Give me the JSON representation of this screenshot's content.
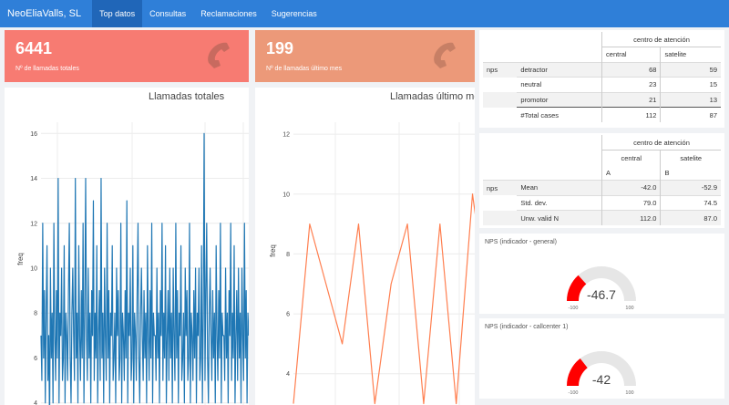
{
  "navbar": {
    "brand": "NeoEliaValls, SL",
    "items": [
      {
        "label": "Top datos",
        "active": true
      },
      {
        "label": "Consultas",
        "active": false
      },
      {
        "label": "Reclamaciones",
        "active": false
      },
      {
        "label": "Sugerencias",
        "active": false
      }
    ]
  },
  "value_boxes": [
    {
      "value": "6441",
      "label": "Nº de llamadas totales",
      "color": "#f77b72",
      "icon": "phone-icon"
    },
    {
      "value": "199",
      "label": "Nº de llamadas último mes",
      "color": "#ec9979",
      "icon": "phone-icon"
    }
  ],
  "table1": {
    "group_header": "centro de atención",
    "col_a": "central",
    "col_b": "satelite",
    "row_var": "nps",
    "rows": [
      {
        "label": "detractor",
        "a": "68",
        "b": "59"
      },
      {
        "label": "neutral",
        "a": "23",
        "b": "15"
      },
      {
        "label": "promotor",
        "a": "21",
        "b": "13"
      },
      {
        "label": "#Total cases",
        "a": "112",
        "b": "87"
      }
    ]
  },
  "table2": {
    "group_header": "centro de atención",
    "col_a": "central",
    "col_b": "satelite",
    "letter_a": "A",
    "letter_b": "B",
    "row_var": "nps",
    "rows": [
      {
        "label": "Mean",
        "a": "-42.0",
        "b": "-52.9"
      },
      {
        "label": "Std. dev.",
        "a": "79.0",
        "b": "74.5"
      },
      {
        "label": "Unw. valid N",
        "a": "112.0",
        "b": "87.0"
      }
    ]
  },
  "gauges": [
    {
      "title": "NPS (indicador - general)",
      "value": -46.7,
      "value_text": "-46.7",
      "min": -100,
      "max": 100,
      "min_text": "-100",
      "max_text": "100"
    },
    {
      "title": "NPS (indicador - callcenter 1)",
      "value": -42,
      "value_text": "-42",
      "min": -100,
      "max": 100,
      "min_text": "-100",
      "max_text": "100"
    }
  ],
  "colors": {
    "navbar": "#2f7fd8",
    "gauge_fill": "#ff0000",
    "gauge_track": "#e6e6e6",
    "chart1_line": "#1f77b4",
    "chart2_line": "#ff7f50"
  },
  "chart_data": [
    {
      "type": "line",
      "title": "Llamadas totales",
      "ylabel": "freq",
      "xlabel": "",
      "ylim": [
        3.5,
        16.5
      ],
      "yticks": [
        4,
        6,
        8,
        10,
        12,
        14,
        16
      ],
      "series": [
        {
          "values": [
            7,
            5,
            12,
            6,
            9,
            4,
            8,
            11,
            5,
            7,
            3,
            10,
            6,
            8,
            4,
            12,
            7,
            5,
            9,
            6,
            14,
            4,
            8,
            7,
            10,
            5,
            6,
            11,
            4,
            8,
            7,
            5,
            9,
            12,
            6,
            4,
            8,
            10,
            7,
            5,
            14,
            6,
            8,
            4,
            11,
            7,
            5,
            9,
            6,
            12,
            4,
            8,
            14,
            7,
            5,
            10,
            6,
            8,
            4,
            9,
            7,
            13,
            5,
            8,
            6,
            11,
            4,
            7,
            9,
            5,
            14,
            6,
            8,
            4,
            10,
            7,
            5,
            12,
            6,
            9,
            4,
            8,
            7,
            11,
            5,
            6,
            8,
            4,
            10,
            7,
            9,
            5,
            6,
            12,
            4,
            8,
            7,
            5,
            9,
            6,
            13,
            4,
            8,
            7,
            10,
            5,
            6,
            11,
            4,
            8,
            7,
            5,
            9,
            12,
            6,
            4,
            8,
            10,
            7,
            5,
            9,
            6,
            8,
            4,
            11,
            7,
            5,
            9,
            6,
            12,
            4,
            8,
            7,
            7,
            5,
            10,
            6,
            8,
            4,
            9,
            7,
            12,
            5,
            8,
            6,
            11,
            4,
            7,
            9,
            5,
            10,
            6,
            8,
            4,
            10,
            7,
            5,
            12,
            6,
            9,
            4,
            8,
            7,
            11,
            5,
            6,
            8,
            4,
            10,
            7,
            9,
            5,
            6,
            12,
            4,
            8,
            7,
            5,
            9,
            6,
            10,
            4,
            8,
            7,
            10,
            5,
            6,
            11,
            4,
            8,
            16,
            5,
            9,
            12,
            6,
            4,
            8,
            10,
            7,
            5,
            9,
            6,
            8,
            4,
            11,
            7,
            5,
            9,
            6,
            12,
            4,
            8,
            7,
            7,
            5,
            10,
            6,
            8,
            4,
            9,
            7,
            12,
            5,
            8,
            6,
            11,
            4,
            7,
            9,
            5,
            10,
            6,
            8,
            4,
            10,
            7,
            5,
            12,
            6,
            9,
            4,
            8,
            7
          ]
        }
      ]
    },
    {
      "type": "line",
      "title": "Llamadas último mes",
      "ylabel": "freq",
      "xlabel": "",
      "ylim": [
        3.2,
        12.4
      ],
      "yticks": [
        4,
        6,
        8,
        10,
        12
      ],
      "series": [
        {
          "values": [
            3,
            9,
            7,
            5,
            9,
            3,
            7,
            9,
            3,
            9,
            3,
            10,
            6,
            3,
            6,
            9
          ]
        }
      ]
    }
  ]
}
